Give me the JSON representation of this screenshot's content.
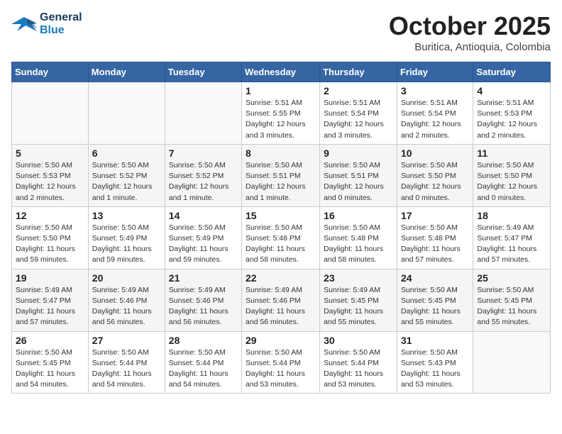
{
  "header": {
    "logo_general": "General",
    "logo_blue": "Blue",
    "month_title": "October 2025",
    "location": "Buritica, Antioquia, Colombia"
  },
  "weekdays": [
    "Sunday",
    "Monday",
    "Tuesday",
    "Wednesday",
    "Thursday",
    "Friday",
    "Saturday"
  ],
  "weeks": [
    [
      {
        "day": "",
        "info": ""
      },
      {
        "day": "",
        "info": ""
      },
      {
        "day": "",
        "info": ""
      },
      {
        "day": "1",
        "info": "Sunrise: 5:51 AM\nSunset: 5:55 PM\nDaylight: 12 hours and 3 minutes."
      },
      {
        "day": "2",
        "info": "Sunrise: 5:51 AM\nSunset: 5:54 PM\nDaylight: 12 hours and 3 minutes."
      },
      {
        "day": "3",
        "info": "Sunrise: 5:51 AM\nSunset: 5:54 PM\nDaylight: 12 hours and 2 minutes."
      },
      {
        "day": "4",
        "info": "Sunrise: 5:51 AM\nSunset: 5:53 PM\nDaylight: 12 hours and 2 minutes."
      }
    ],
    [
      {
        "day": "5",
        "info": "Sunrise: 5:50 AM\nSunset: 5:53 PM\nDaylight: 12 hours and 2 minutes."
      },
      {
        "day": "6",
        "info": "Sunrise: 5:50 AM\nSunset: 5:52 PM\nDaylight: 12 hours and 1 minute."
      },
      {
        "day": "7",
        "info": "Sunrise: 5:50 AM\nSunset: 5:52 PM\nDaylight: 12 hours and 1 minute."
      },
      {
        "day": "8",
        "info": "Sunrise: 5:50 AM\nSunset: 5:51 PM\nDaylight: 12 hours and 1 minute."
      },
      {
        "day": "9",
        "info": "Sunrise: 5:50 AM\nSunset: 5:51 PM\nDaylight: 12 hours and 0 minutes."
      },
      {
        "day": "10",
        "info": "Sunrise: 5:50 AM\nSunset: 5:50 PM\nDaylight: 12 hours and 0 minutes."
      },
      {
        "day": "11",
        "info": "Sunrise: 5:50 AM\nSunset: 5:50 PM\nDaylight: 12 hours and 0 minutes."
      }
    ],
    [
      {
        "day": "12",
        "info": "Sunrise: 5:50 AM\nSunset: 5:50 PM\nDaylight: 11 hours and 59 minutes."
      },
      {
        "day": "13",
        "info": "Sunrise: 5:50 AM\nSunset: 5:49 PM\nDaylight: 11 hours and 59 minutes."
      },
      {
        "day": "14",
        "info": "Sunrise: 5:50 AM\nSunset: 5:49 PM\nDaylight: 11 hours and 59 minutes."
      },
      {
        "day": "15",
        "info": "Sunrise: 5:50 AM\nSunset: 5:48 PM\nDaylight: 11 hours and 58 minutes."
      },
      {
        "day": "16",
        "info": "Sunrise: 5:50 AM\nSunset: 5:48 PM\nDaylight: 11 hours and 58 minutes."
      },
      {
        "day": "17",
        "info": "Sunrise: 5:50 AM\nSunset: 5:48 PM\nDaylight: 11 hours and 57 minutes."
      },
      {
        "day": "18",
        "info": "Sunrise: 5:49 AM\nSunset: 5:47 PM\nDaylight: 11 hours and 57 minutes."
      }
    ],
    [
      {
        "day": "19",
        "info": "Sunrise: 5:49 AM\nSunset: 5:47 PM\nDaylight: 11 hours and 57 minutes."
      },
      {
        "day": "20",
        "info": "Sunrise: 5:49 AM\nSunset: 5:46 PM\nDaylight: 11 hours and 56 minutes."
      },
      {
        "day": "21",
        "info": "Sunrise: 5:49 AM\nSunset: 5:46 PM\nDaylight: 11 hours and 56 minutes."
      },
      {
        "day": "22",
        "info": "Sunrise: 5:49 AM\nSunset: 5:46 PM\nDaylight: 11 hours and 56 minutes."
      },
      {
        "day": "23",
        "info": "Sunrise: 5:49 AM\nSunset: 5:45 PM\nDaylight: 11 hours and 55 minutes."
      },
      {
        "day": "24",
        "info": "Sunrise: 5:50 AM\nSunset: 5:45 PM\nDaylight: 11 hours and 55 minutes."
      },
      {
        "day": "25",
        "info": "Sunrise: 5:50 AM\nSunset: 5:45 PM\nDaylight: 11 hours and 55 minutes."
      }
    ],
    [
      {
        "day": "26",
        "info": "Sunrise: 5:50 AM\nSunset: 5:45 PM\nDaylight: 11 hours and 54 minutes."
      },
      {
        "day": "27",
        "info": "Sunrise: 5:50 AM\nSunset: 5:44 PM\nDaylight: 11 hours and 54 minutes."
      },
      {
        "day": "28",
        "info": "Sunrise: 5:50 AM\nSunset: 5:44 PM\nDaylight: 11 hours and 54 minutes."
      },
      {
        "day": "29",
        "info": "Sunrise: 5:50 AM\nSunset: 5:44 PM\nDaylight: 11 hours and 53 minutes."
      },
      {
        "day": "30",
        "info": "Sunrise: 5:50 AM\nSunset: 5:44 PM\nDaylight: 11 hours and 53 minutes."
      },
      {
        "day": "31",
        "info": "Sunrise: 5:50 AM\nSunset: 5:43 PM\nDaylight: 11 hours and 53 minutes."
      },
      {
        "day": "",
        "info": ""
      }
    ]
  ]
}
